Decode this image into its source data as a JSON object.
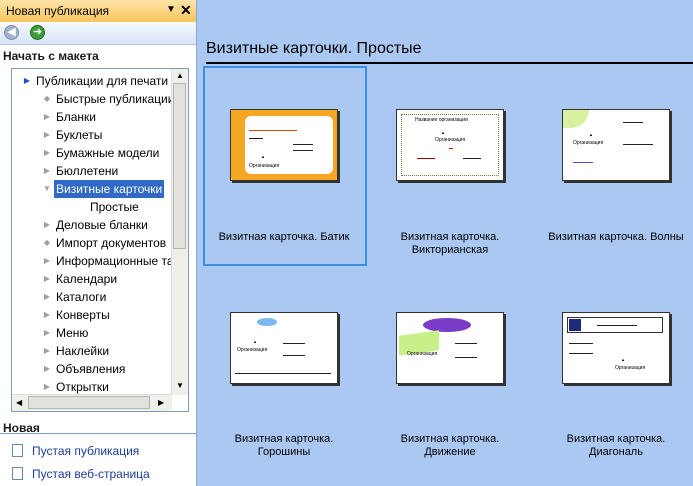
{
  "pane": {
    "title": "Новая публикация",
    "dropdown_glyph": "▼",
    "close_glyph": "✕",
    "back_glyph": "◀",
    "forward_glyph": "➜",
    "section_start": "Начать с макета",
    "tree": [
      {
        "label": "Публикации для печати",
        "icon": "▶",
        "indent": 0
      },
      {
        "label": "Быстрые публикации",
        "icon": "◆",
        "indent": 1
      },
      {
        "label": "Бланки",
        "icon": "▶",
        "indent": 1
      },
      {
        "label": "Буклеты",
        "icon": "▶",
        "indent": 1
      },
      {
        "label": "Бумажные модели",
        "icon": "▶",
        "indent": 1
      },
      {
        "label": "Бюллетени",
        "icon": "▶",
        "indent": 1
      },
      {
        "label": "Визитные карточки",
        "icon": "▼",
        "indent": 1,
        "selected": true
      },
      {
        "label": "Простые",
        "icon": "",
        "indent": 2
      },
      {
        "label": "Деловые бланки",
        "icon": "▶",
        "indent": 1
      },
      {
        "label": "Импорт документов",
        "icon": "◆",
        "indent": 1
      },
      {
        "label": "Информационные та",
        "icon": "▶",
        "indent": 1
      },
      {
        "label": "Календари",
        "icon": "▶",
        "indent": 1
      },
      {
        "label": "Каталоги",
        "icon": "▶",
        "indent": 1
      },
      {
        "label": "Конверты",
        "icon": "▶",
        "indent": 1
      },
      {
        "label": "Меню",
        "icon": "▶",
        "indent": 1
      },
      {
        "label": "Наклейки",
        "icon": "▶",
        "indent": 1
      },
      {
        "label": "Объявления",
        "icon": "▶",
        "indent": 1
      },
      {
        "label": "Открытки",
        "icon": "▶",
        "indent": 1
      }
    ],
    "section_new": "Новая",
    "new_links": [
      "Пустая публикация",
      "Пустая веб-страница"
    ]
  },
  "main": {
    "title": "Визитные карточки. Простые",
    "templates": [
      {
        "line1": "Визитная карточка. Батик",
        "line2": ""
      },
      {
        "line1": "Визитная карточка.",
        "line2": "Викторианская"
      },
      {
        "line1": "Визитная карточка. Волны",
        "line2": ""
      },
      {
        "line1": "Визитная карточка.",
        "line2": "Горошины"
      },
      {
        "line1": "Визитная карточка.",
        "line2": "Движение"
      },
      {
        "line1": "Визитная карточка.",
        "line2": "Диагональ"
      }
    ],
    "thumb_text": {
      "org": "Организация",
      "title_text": "Название организации"
    }
  },
  "colors": {
    "accent": "#3b8fe0",
    "selection": "#316ac5",
    "background": "#aac8f2"
  }
}
